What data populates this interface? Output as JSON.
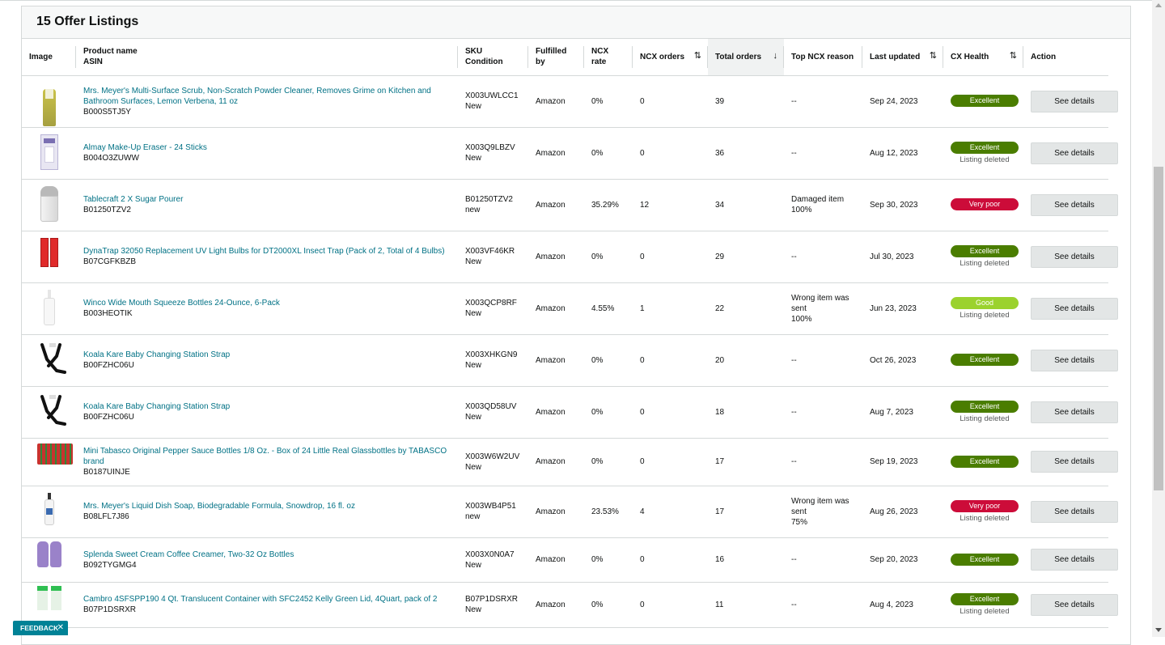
{
  "card": {
    "title": "15 Offer Listings"
  },
  "columns": {
    "image": "Image",
    "product_name": "Product name",
    "asin": "ASIN",
    "sku": "SKU",
    "condition": "Condition",
    "fulfilled_by": "Fulfilled by",
    "ncx_rate": "NCX rate",
    "ncx_orders": "NCX orders",
    "total_orders": "Total orders",
    "top_ncx_reason": "Top NCX reason",
    "last_updated": "Last updated",
    "cx_health": "CX Health",
    "action": "Action"
  },
  "colors": {
    "excellent": "#4a7d00",
    "very_poor": "#cc0c39",
    "good": "#9bd22e",
    "link": "#007185"
  },
  "rows": [
    {
      "image_icon": "spray-bottle-product-icon",
      "name": "Mrs. Meyer's Multi-Surface Scrub, Non-Scratch Powder Cleaner, Removes Grime on Kitchen and Bathroom Surfaces, Lemon Verbena, 11 oz",
      "asin": "B000S5TJ5Y",
      "sku": "X003UWLCC1",
      "condition": "New",
      "fulfilled_by": "Amazon",
      "ncx_rate": "0%",
      "ncx_orders": "0",
      "total_orders": "39",
      "reason": "--",
      "reason_pct": "",
      "last_updated": "Sep 24, 2023",
      "health": "Excellent",
      "health_sub": "",
      "action": "See details"
    },
    {
      "image_icon": "makeup-eraser-product-icon",
      "name": "Almay Make-Up Eraser - 24 Sticks",
      "asin": "B004O3ZUWW",
      "sku": "X003Q9LBZV",
      "condition": "New",
      "fulfilled_by": "Amazon",
      "ncx_rate": "0%",
      "ncx_orders": "0",
      "total_orders": "36",
      "reason": "--",
      "reason_pct": "",
      "last_updated": "Aug 12, 2023",
      "health": "Excellent",
      "health_sub": "Listing deleted",
      "action": "See details"
    },
    {
      "image_icon": "sugar-pourer-product-icon",
      "name": "Tablecraft 2 X Sugar Pourer",
      "asin": "B01250TZV2",
      "sku": "B01250TZV2",
      "condition": "new",
      "fulfilled_by": "Amazon",
      "ncx_rate": "35.29%",
      "ncx_orders": "12",
      "total_orders": "34",
      "reason": "Damaged item",
      "reason_pct": "100%",
      "last_updated": "Sep 30, 2023",
      "health": "Very poor",
      "health_sub": "",
      "action": "See details"
    },
    {
      "image_icon": "uv-bulb-product-icon",
      "name": "DynaTrap 32050 Replacement UV Light Bulbs for DT2000XL Insect Trap (Pack of 2, Total of 4 Bulbs)",
      "asin": "B07CGFKBZB",
      "sku": "X003VF46KR",
      "condition": "New",
      "fulfilled_by": "Amazon",
      "ncx_rate": "0%",
      "ncx_orders": "0",
      "total_orders": "29",
      "reason": "--",
      "reason_pct": "",
      "last_updated": "Jul 30, 2023",
      "health": "Excellent",
      "health_sub": "Listing deleted",
      "action": "See details"
    },
    {
      "image_icon": "squeeze-bottle-product-icon",
      "name": "Winco Wide Mouth Squeeze Bottles 24-Ounce, 6-Pack",
      "asin": "B003HEOTIK",
      "sku": "X003QCP8RF",
      "condition": "New",
      "fulfilled_by": "Amazon",
      "ncx_rate": "4.55%",
      "ncx_orders": "1",
      "total_orders": "22",
      "reason": "Wrong item was sent",
      "reason_pct": "100%",
      "last_updated": "Jun 23, 2023",
      "health": "Good",
      "health_sub": "Listing deleted",
      "action": "See details"
    },
    {
      "image_icon": "strap-product-icon",
      "name": "Koala Kare Baby Changing Station Strap",
      "asin": "B00FZHC06U",
      "sku": "X003XHKGN9",
      "condition": "New",
      "fulfilled_by": "Amazon",
      "ncx_rate": "0%",
      "ncx_orders": "0",
      "total_orders": "20",
      "reason": "--",
      "reason_pct": "",
      "last_updated": "Oct 26, 2023",
      "health": "Excellent",
      "health_sub": "",
      "action": "See details"
    },
    {
      "image_icon": "strap-product-icon",
      "name": "Koala Kare Baby Changing Station Strap",
      "asin": "B00FZHC06U",
      "sku": "X003QD58UV",
      "condition": "New",
      "fulfilled_by": "Amazon",
      "ncx_rate": "0%",
      "ncx_orders": "0",
      "total_orders": "18",
      "reason": "--",
      "reason_pct": "",
      "last_updated": "Aug 7, 2023",
      "health": "Excellent",
      "health_sub": "Listing deleted",
      "action": "See details"
    },
    {
      "image_icon": "sauce-bottles-product-icon",
      "name": "Mini Tabasco Original Pepper Sauce Bottles 1/8 Oz. - Box of 24 Little Real Glassbottles by TABASCO brand",
      "asin": "B0187UINJE",
      "sku": "X003W6W2UV",
      "condition": "New",
      "fulfilled_by": "Amazon",
      "ncx_rate": "0%",
      "ncx_orders": "0",
      "total_orders": "17",
      "reason": "--",
      "reason_pct": "",
      "last_updated": "Sep 19, 2023",
      "health": "Excellent",
      "health_sub": "",
      "action": "See details"
    },
    {
      "image_icon": "dish-soap-product-icon",
      "name": "Mrs. Meyer's Liquid Dish Soap, Biodegradable Formula, Snowdrop, 16 fl. oz",
      "asin": "B08LFL7J86",
      "sku": "X003WB4P51",
      "condition": "new",
      "fulfilled_by": "Amazon",
      "ncx_rate": "23.53%",
      "ncx_orders": "4",
      "total_orders": "17",
      "reason": "Wrong item was sent",
      "reason_pct": "75%",
      "last_updated": "Aug 26, 2023",
      "health": "Very poor",
      "health_sub": "Listing deleted",
      "action": "See details"
    },
    {
      "image_icon": "creamer-bottles-product-icon",
      "name": "Splenda Sweet Cream Coffee Creamer, Two-32 Oz Bottles",
      "asin": "B092TYGMG4",
      "sku": "X003X0N0A7",
      "condition": "New",
      "fulfilled_by": "Amazon",
      "ncx_rate": "0%",
      "ncx_orders": "0",
      "total_orders": "16",
      "reason": "--",
      "reason_pct": "",
      "last_updated": "Sep 20, 2023",
      "health": "Excellent",
      "health_sub": "",
      "action": "See details"
    },
    {
      "image_icon": "container-product-icon",
      "name": "Cambro 4SFSPP190 4 Qt. Translucent Container with SFC2452 Kelly Green Lid, 4Quart, pack of 2",
      "asin": "B07P1DSRXR",
      "sku": "B07P1DSRXR",
      "condition": "New",
      "fulfilled_by": "Amazon",
      "ncx_rate": "0%",
      "ncx_orders": "0",
      "total_orders": "11",
      "reason": "--",
      "reason_pct": "",
      "last_updated": "Aug 4, 2023",
      "health": "Excellent",
      "health_sub": "Listing deleted",
      "action": "See details"
    }
  ],
  "feedback": {
    "label": "FEEDBACK",
    "close": "✕"
  }
}
